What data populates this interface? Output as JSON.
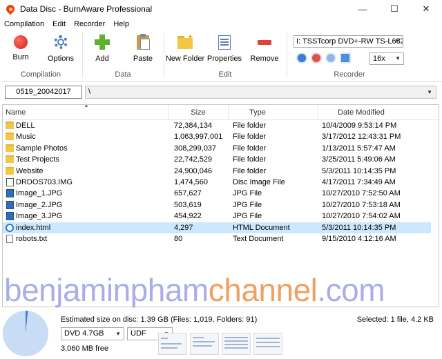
{
  "window": {
    "title": "Data Disc - BurnAware Professional",
    "controls": [
      "—",
      "☐",
      "✕"
    ]
  },
  "menu": [
    "Compilation",
    "Edit",
    "Recorder",
    "Help"
  ],
  "ribbon": {
    "compilation": {
      "label": "Compilation",
      "burn": "Burn",
      "options": "Options"
    },
    "data": {
      "label": "Data",
      "add": "Add",
      "paste": "Paste"
    },
    "edit": {
      "label": "Edit",
      "new_folder": "New Folder",
      "properties": "Properties",
      "remove": "Remove"
    },
    "recorder": {
      "label": "Recorder",
      "drive": "I: TSSTcorp DVD+-RW TS-L632",
      "speed": "16x"
    }
  },
  "path": {
    "disc_label": "0519_20042017",
    "current": "\\"
  },
  "columns": [
    "Name",
    "Size",
    "Type",
    "Date Modified"
  ],
  "files": [
    {
      "name": "DELL",
      "size": "72,384,134",
      "type": "File folder",
      "date": "10/4/2009 9:53:14 PM",
      "icon": "folder"
    },
    {
      "name": "Music",
      "size": "1,063,997,001",
      "type": "File folder",
      "date": "3/17/2012 12:43:31 PM",
      "icon": "folder"
    },
    {
      "name": "Sample Photos",
      "size": "308,299,037",
      "type": "File folder",
      "date": "1/13/2011 5:57:47 AM",
      "icon": "folder"
    },
    {
      "name": "Test Projects",
      "size": "22,742,529",
      "type": "File folder",
      "date": "3/25/2011 5:49:06 AM",
      "icon": "folder"
    },
    {
      "name": "Website",
      "size": "24,900,046",
      "type": "File folder",
      "date": "5/3/2011 10:14:35 PM",
      "icon": "folder"
    },
    {
      "name": "DRDOS703.IMG",
      "size": "1,474,560",
      "type": "Disc Image File",
      "date": "4/17/2011 7:34:49 AM",
      "icon": "disc"
    },
    {
      "name": "Image_1.JPG",
      "size": "657,627",
      "type": "JPG File",
      "date": "10/27/2010 7:52:50 AM",
      "icon": "img"
    },
    {
      "name": "Image_2.JPG",
      "size": "503,619",
      "type": "JPG File",
      "date": "10/27/2010 7:53:18 AM",
      "icon": "img"
    },
    {
      "name": "Image_3.JPG",
      "size": "454,922",
      "type": "JPG File",
      "date": "10/27/2010 7:54:02 AM",
      "icon": "img"
    },
    {
      "name": "index.html",
      "size": "4,297",
      "type": "HTML Document",
      "date": "5/3/2011 10:14:35 PM",
      "icon": "html",
      "selected": true
    },
    {
      "name": "robots.txt",
      "size": "80",
      "type": "Text Document",
      "date": "9/15/2010 4:12:16 AM",
      "icon": "file"
    }
  ],
  "watermark": {
    "part1": "benjaminpham",
    "part2": "channel",
    "part3": ".com"
  },
  "status": {
    "estimated": "Estimated size on disc: 1.39 GB (Files: 1,019, Folders: 91)",
    "selected": "Selected: 1 file, 4.2 KB",
    "disc_type": "DVD 4.7GB",
    "file_system": "UDF",
    "free": "3,060 MB free",
    "used_fraction": 0.017
  },
  "colors": {
    "selection": "#cce8ff",
    "folder": "#f3c645",
    "watermark_a": "#a9aee8",
    "watermark_b": "#f0a060"
  }
}
